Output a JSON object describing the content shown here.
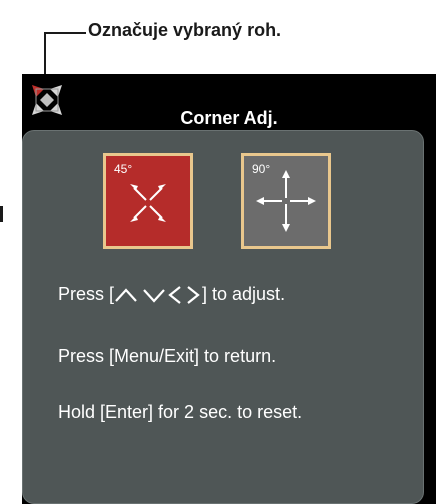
{
  "callout": {
    "label": "Označuje vybraný roh."
  },
  "osd": {
    "title": "Corner Adj.",
    "modes": [
      {
        "label": "45°",
        "selected": true,
        "color": "#b52c2a"
      },
      {
        "label": "90°",
        "selected": false,
        "color": "#6c6c6c"
      }
    ],
    "instructions": {
      "adjust_prefix": "Press [",
      "adjust_suffix": "] to adjust.",
      "return": "Press [Menu/Exit] to return.",
      "reset": "Hold [Enter] for 2 sec. to reset."
    },
    "icons": [
      "corner-indicator-icon",
      "up-arrow-icon",
      "down-arrow-icon",
      "left-arrow-icon",
      "right-arrow-icon"
    ]
  },
  "colors": {
    "panel": "#4f5656",
    "selected_corner": "#c0302c",
    "tile_border": "#e9c78d"
  }
}
